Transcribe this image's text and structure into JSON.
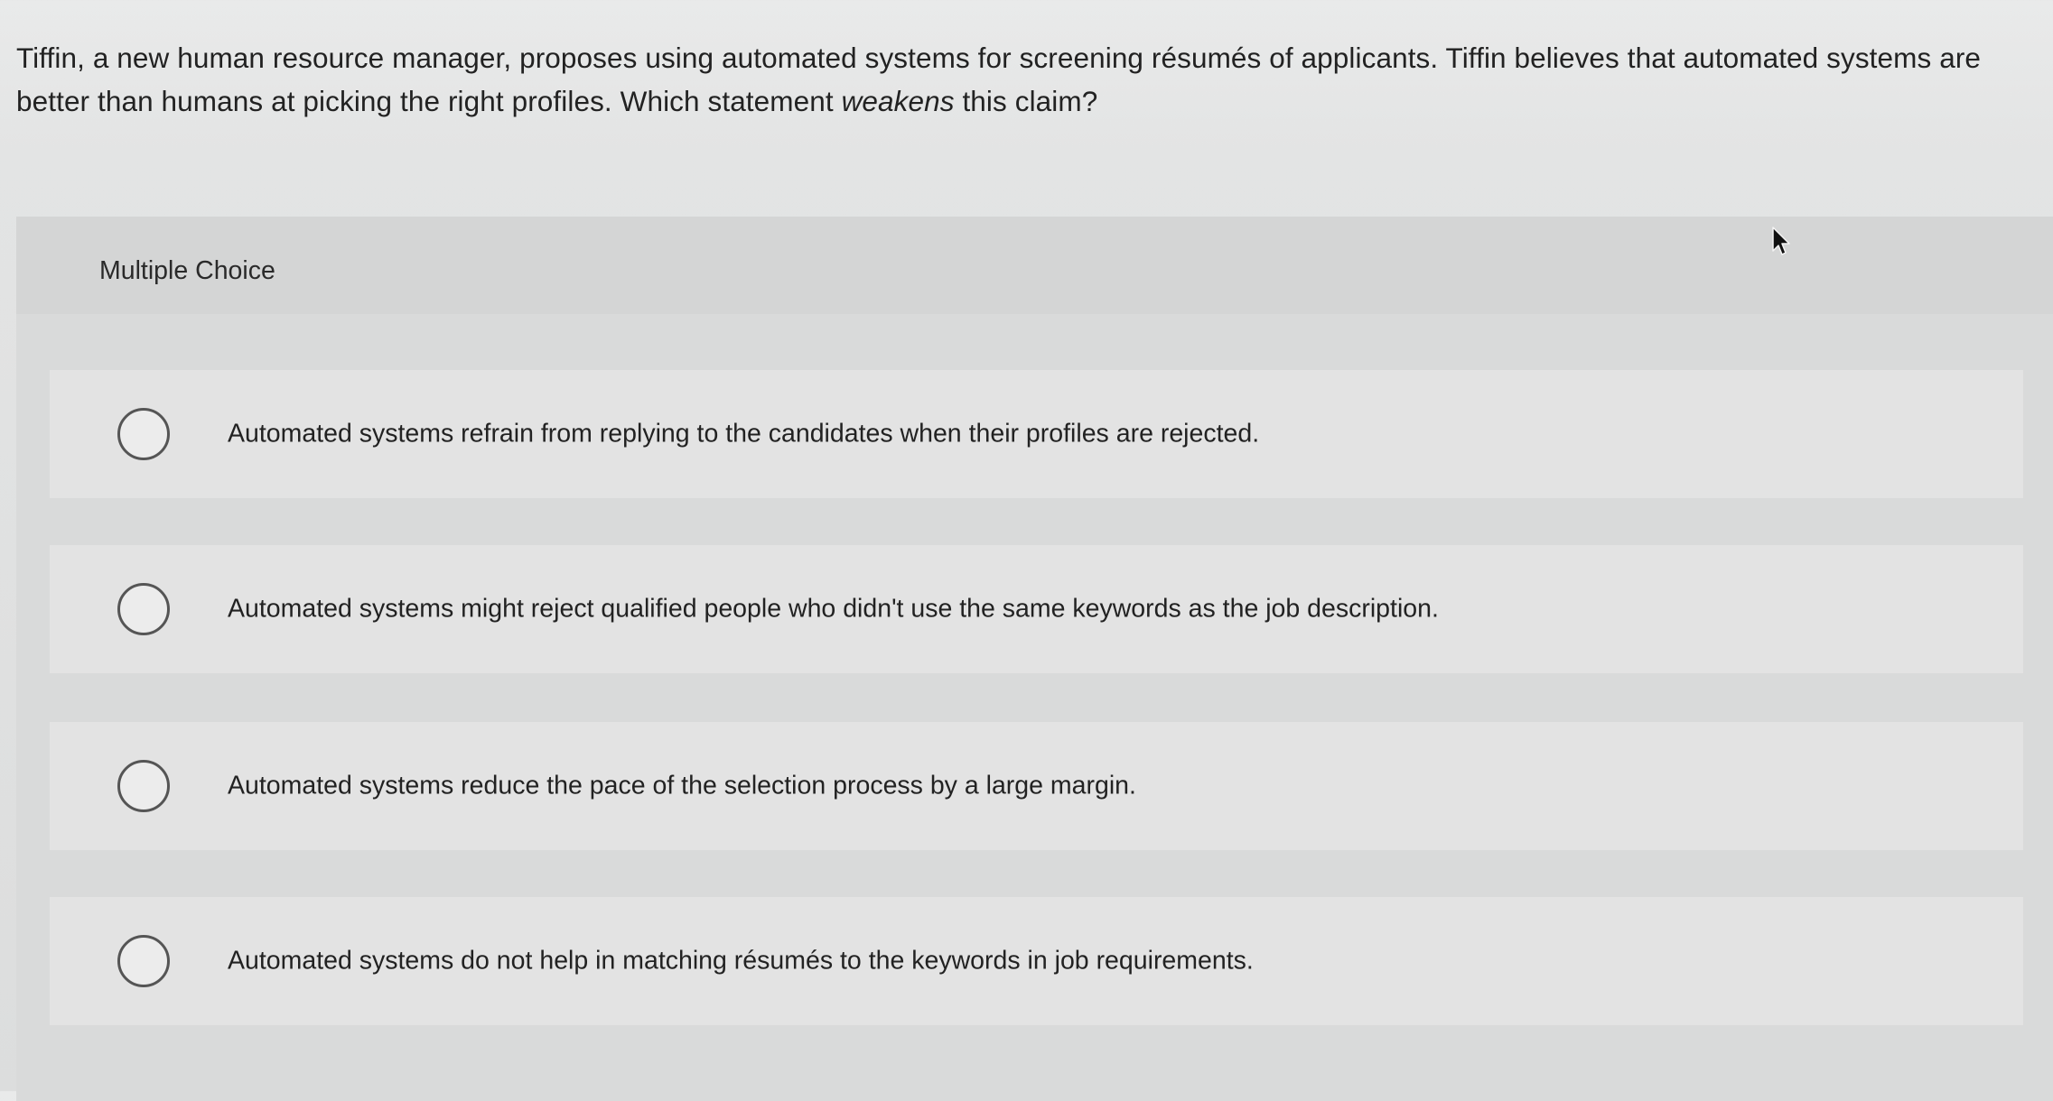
{
  "question": {
    "text_before": "Tiffin, a new human resource manager, proposes using automated systems for screening résumés of applicants. Tiffin believes that automated systems are better than humans at picking the right profiles. Which statement ",
    "emphasis": "weakens",
    "text_after": " this claim?"
  },
  "panel": {
    "header_label": "Multiple Choice"
  },
  "options": [
    {
      "label": "Automated systems refrain from replying to the candidates when their profiles are rejected.",
      "selected": false
    },
    {
      "label": "Automated systems might reject qualified people who didn't use the same keywords as the job description.",
      "selected": false
    },
    {
      "label": "Automated systems reduce the pace of the selection process by a large margin.",
      "selected": false
    },
    {
      "label": "Automated systems do not help in matching résumés to the keywords in job requirements.",
      "selected": false
    }
  ],
  "icons": {
    "radio": "radio-button-icon",
    "cursor": "mouse-pointer-icon"
  }
}
